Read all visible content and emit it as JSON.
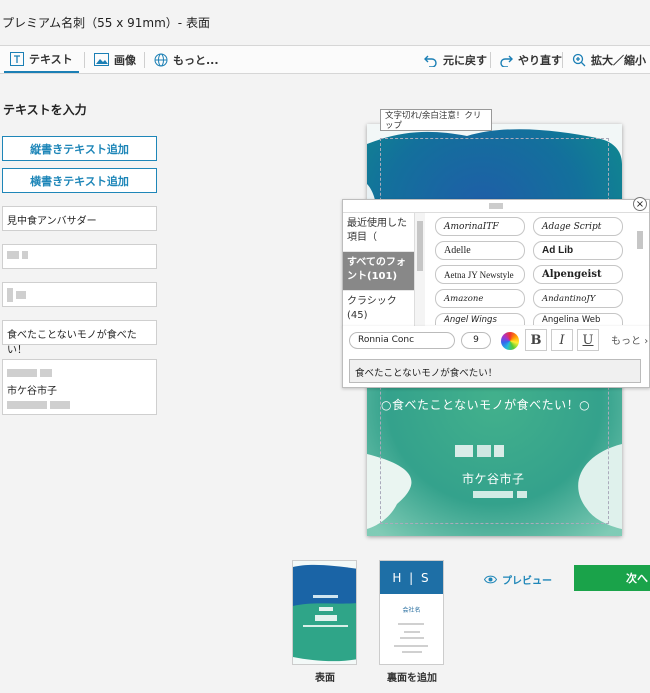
{
  "title": "プレミアム名刺（55 x 91mm）- 表面",
  "toolbar": {
    "text_tab": "テキスト",
    "image_tab": "画像",
    "more_tab": "もっと...",
    "undo": "元に戻す",
    "redo": "やり直す",
    "zoom": "拡大／縮小"
  },
  "left_panel": {
    "heading": "テキストを入力",
    "add_vertical": "縦書きテキスト追加",
    "add_horizontal": "横書きテキスト追加",
    "field1": "見中食アンバサダー",
    "field4": "食べたことないモノが食べたい！",
    "field5_line2": "市ケ谷市子"
  },
  "tooltip": "文字切れ/余白注意！クリップ",
  "font_panel": {
    "categories": [
      "最近使用した項目（",
      "すべてのフォント(101)",
      "クラシック(45)"
    ],
    "fonts": [
      "AmorinaITF",
      "Adage Script",
      "Adelle",
      "Ad Lib",
      "Aetna JY Newstyle",
      "Alpengeist",
      "Amazone",
      "AndantinoJY",
      "Angel Wings",
      "Angelina Web"
    ],
    "current_font": "Ronnia Conc",
    "size": "9",
    "bold": "B",
    "italic": "I",
    "underline": "U",
    "more": "もっと",
    "text_value": "食べたことないモノが食べたい！"
  },
  "card": {
    "tagline": "○食べたことないモノが食べたい！○",
    "name": "市ケ谷市子"
  },
  "bottom": {
    "front_caption": "表面",
    "add_back_caption": "裏面を追加",
    "preview": "プレビュー",
    "next": "次へ",
    "back_letters": "H | S",
    "back_company": "会社名"
  },
  "colors": {
    "accent": "#1e86b8",
    "next": "#1aa34a"
  }
}
